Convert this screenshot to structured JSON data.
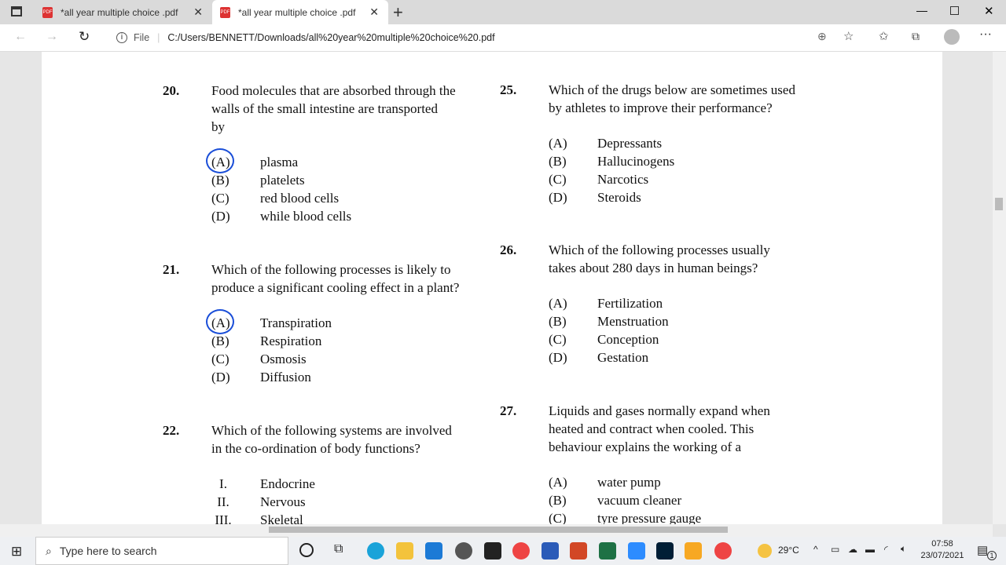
{
  "browser": {
    "tabs": [
      {
        "label": "*all year multiple choice .pdf",
        "active": false
      },
      {
        "label": "*all year multiple choice .pdf",
        "active": true
      }
    ],
    "address": {
      "scheme": "File",
      "url": "C:/Users/BENNETT/Downloads/all%20year%20multiple%20choice%20.pdf"
    },
    "icons": [
      "tab-actions-icon",
      "pdf-icon",
      "close-icon",
      "new-tab-icon",
      "back-icon",
      "forward-icon",
      "refresh-icon",
      "info-icon",
      "zoom-icon",
      "favorite-add-icon",
      "favorites-icon",
      "collections-icon",
      "profile-icon",
      "more-icon",
      "minimize-icon",
      "maximize-icon",
      "close-window-icon"
    ]
  },
  "document": {
    "left": [
      {
        "number": "20.",
        "text": [
          "Food molecules that are absorbed through the",
          "walls of the small intestine are transported",
          "by"
        ],
        "options": [
          {
            "label": "(A)",
            "text": "plasma",
            "circled": true
          },
          {
            "label": "(B)",
            "text": "platelets"
          },
          {
            "label": "(C)",
            "text": "red blood cells"
          },
          {
            "label": "(D)",
            "text": "while blood cells"
          }
        ]
      },
      {
        "number": "21.",
        "text": [
          "Which of the following processes is likely to",
          "produce a significant cooling effect in a plant?"
        ],
        "options": [
          {
            "label": "(A)",
            "text": "Transpiration",
            "circled": true
          },
          {
            "label": "(B)",
            "text": "Respiration"
          },
          {
            "label": "(C)",
            "text": "Osmosis"
          },
          {
            "label": "(D)",
            "text": "Diffusion"
          }
        ]
      },
      {
        "number": "22.",
        "text": [
          "Which of the following systems are involved",
          "in the co-ordination of body functions?"
        ],
        "options": [
          {
            "label": "I.",
            "text": "Endocrine"
          },
          {
            "label": "II.",
            "text": "Nervous"
          },
          {
            "label": "III.",
            "text": "Skeletal"
          }
        ]
      }
    ],
    "right": [
      {
        "number": "25.",
        "text": [
          "Which of the drugs below are sometimes used",
          "by athletes to improve their performance?"
        ],
        "options": [
          {
            "label": "(A)",
            "text": "Depressants"
          },
          {
            "label": "(B)",
            "text": "Hallucinogens"
          },
          {
            "label": "(C)",
            "text": "Narcotics"
          },
          {
            "label": "(D)",
            "text": "Steroids"
          }
        ]
      },
      {
        "number": "26.",
        "text": [
          "Which of the following processes usually",
          "takes about 280 days in human beings?"
        ],
        "options": [
          {
            "label": "(A)",
            "text": "Fertilization"
          },
          {
            "label": "(B)",
            "text": "Menstruation"
          },
          {
            "label": "(C)",
            "text": "Conception"
          },
          {
            "label": "(D)",
            "text": "Gestation"
          }
        ]
      },
      {
        "number": "27.",
        "text": [
          "Liquids and gases normally expand when",
          "heated and contract when cooled. This",
          "behaviour explains the working of a"
        ],
        "options": [
          {
            "label": "(A)",
            "text": "water pump"
          },
          {
            "label": "(B)",
            "text": "vacuum cleaner"
          },
          {
            "label": "(C)",
            "text": "tyre pressure gauge"
          }
        ]
      }
    ],
    "annotation_color": "#1a4ed8"
  },
  "taskbar": {
    "search_placeholder": "Type here to search",
    "weather": "29°C",
    "time": "07:58",
    "date": "23/07/2021",
    "notifications": "1"
  }
}
